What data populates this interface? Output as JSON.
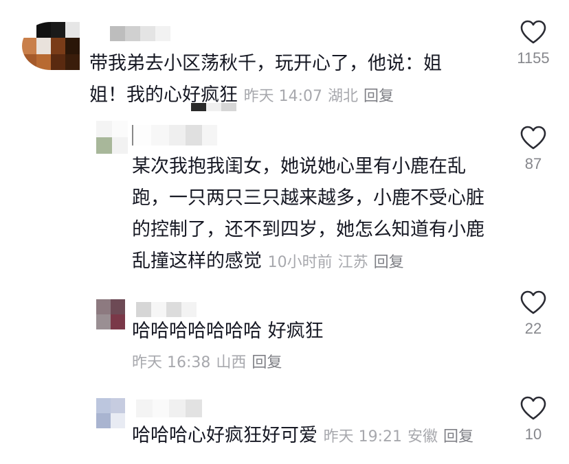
{
  "comments": [
    {
      "text": "带我弟去小区荡秋千，玩开心了，他说：姐姐！我的心好疯狂",
      "time": "昨天 14:07",
      "location": "湖北",
      "reply_label": "回复",
      "likes": "1155",
      "like_icon": "heart-outline-icon"
    },
    {
      "text": "某次我抱我闺女，她说她心里有小鹿在乱跑，一只两只三只越来越多，小鹿不受心脏的控制了，还不到四岁，她怎么知道有小鹿乱撞这样的感觉",
      "time": "10小时前",
      "location": "江苏",
      "reply_label": "回复",
      "likes": "87",
      "like_icon": "heart-outline-icon"
    },
    {
      "text": "哈哈哈哈哈哈哈 好疯狂",
      "time": "昨天 16:38",
      "location": "山西",
      "reply_label": "回复",
      "likes": "22",
      "like_icon": "heart-outline-icon"
    },
    {
      "text": "哈哈哈心好疯狂好可爱",
      "time": "昨天 19:21",
      "location": "安徽",
      "reply_label": "回复",
      "likes": "10",
      "like_icon": "heart-outline-icon"
    }
  ],
  "colors": {
    "text": "#161823",
    "meta": "#a7a8ad",
    "reply": "#7f8086",
    "count": "#86878c",
    "heart_stroke": "#2a2b33"
  }
}
